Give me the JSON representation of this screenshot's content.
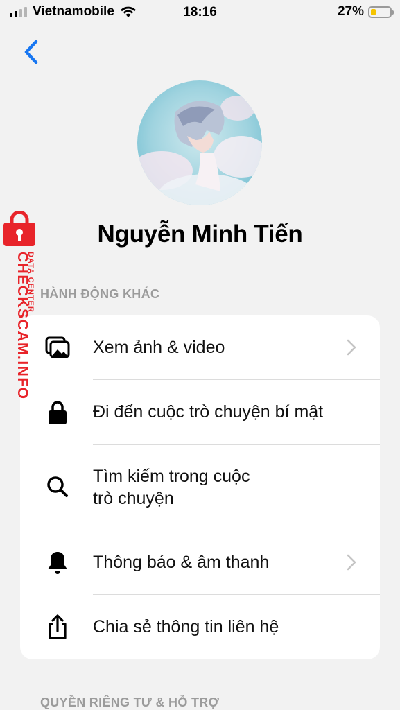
{
  "status_bar": {
    "carrier": "Vietnamobile",
    "time": "18:16",
    "battery_percent": "27%",
    "battery_level": 0.27,
    "battery_color": "#f5c400"
  },
  "header": {
    "back_icon": "chevron-left-icon",
    "accent_color": "#1877f2"
  },
  "profile": {
    "name": "Nguyễn Minh Tiến"
  },
  "sections": {
    "other_actions_title": "HÀNH ĐỘNG KHÁC",
    "privacy_title": "QUYỀN RIÊNG TƯ & HỖ TRỢ"
  },
  "actions": [
    {
      "label": "Xem ảnh & video",
      "icon": "photo-gallery-icon",
      "has_chevron": true
    },
    {
      "label": "Đi đến cuộc trò chuyện bí mật",
      "icon": "lock-icon",
      "has_chevron": false
    },
    {
      "label_line1": "Tìm kiếm trong cuộc",
      "label_line2": "trò chuyện",
      "icon": "search-icon",
      "has_chevron": false
    },
    {
      "label": "Thông báo & âm thanh",
      "icon": "bell-icon",
      "has_chevron": true
    },
    {
      "label": "Chia sẻ thông tin liên hệ",
      "icon": "share-icon",
      "has_chevron": false
    }
  ],
  "watermark": {
    "brand": "CHECKSCAM.INFO",
    "subtitle": "DATA CENTER",
    "color": "#e8242a"
  }
}
